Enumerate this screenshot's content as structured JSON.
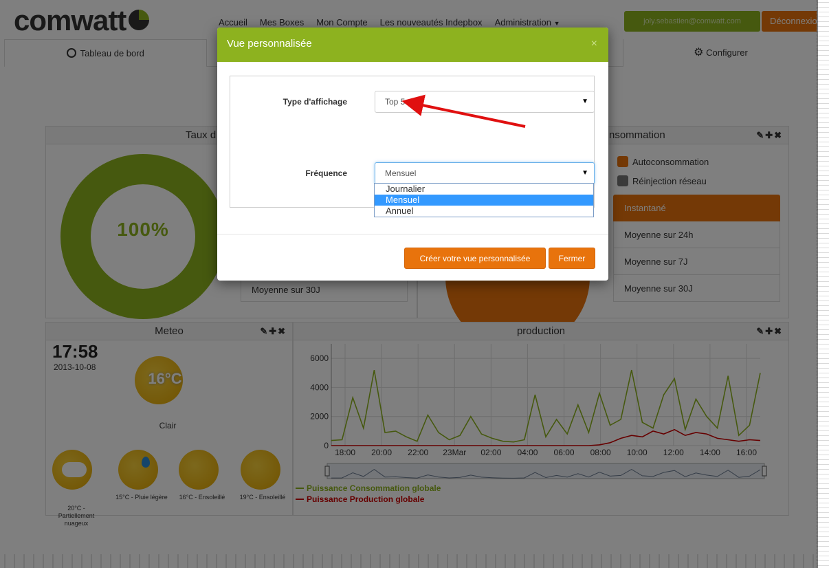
{
  "app": {
    "logo_text": "comwatt",
    "brand_green": "#8db21f",
    "brand_orange": "#e8730c"
  },
  "nav": {
    "items": [
      "Accueil",
      "Mes Boxes",
      "Mon Compte",
      "Les nouveautés Indepbox",
      "Administration"
    ],
    "user_email": "joly.sebastien@comwatt.com",
    "logout_label": "Déconnexion"
  },
  "tabs": {
    "dashboard_label": "Tableau de bord",
    "config_label": "Configurer"
  },
  "panels": {
    "taux_title_partial": "Taux d",
    "conso_title_partial": "nsommation",
    "tools": "✎✚✖",
    "donut_value": "100%",
    "legend": [
      "Autoconsommation",
      "Réinjection réseau"
    ],
    "averages": [
      "Instantané",
      "Moyenne sur 24h",
      "Moyenne sur 7J",
      "Moyenne sur 30J"
    ],
    "left_average": "Moyenne sur 30J",
    "meteo_title": "Meteo",
    "production_title": "production"
  },
  "meteo": {
    "time": "17:58",
    "date": "2013-10-08",
    "temp": "16°C",
    "condition": "Clair",
    "forecast": [
      {
        "label": "20°C - Partiellement nuageux",
        "icon": "sun-cloud-icon"
      },
      {
        "label": "15°C - Pluie légère",
        "icon": "sun-rain-icon"
      },
      {
        "label": "16°C - Ensoleillé",
        "icon": "sun-icon"
      },
      {
        "label": "19°C - Ensoleillé",
        "icon": "sun-icon"
      }
    ]
  },
  "chart_data": {
    "type": "line",
    "title": "production",
    "x_ticks": [
      "18:00",
      "20:00",
      "22:00",
      "23Mar",
      "02:00",
      "04:00",
      "06:00",
      "08:00",
      "10:00",
      "12:00",
      "14:00",
      "16:00"
    ],
    "y_ticks": [
      "0",
      "2000",
      "4000",
      "6000"
    ],
    "ylim": [
      0,
      7000
    ],
    "series": [
      {
        "name": "Puissance Consommation globale",
        "color": "#8db21f",
        "values": [
          350,
          400,
          3300,
          1200,
          5200,
          900,
          1000,
          600,
          300,
          2100,
          900,
          400,
          700,
          2000,
          800,
          500,
          300,
          250,
          400,
          3500,
          600,
          1800,
          800,
          2800,
          900,
          3600,
          1400,
          1800,
          5200,
          1600,
          1200,
          3500,
          4600,
          1100,
          3200,
          2000,
          1200,
          4800,
          700,
          1400,
          5000
        ]
      },
      {
        "name": "Puissance Production globale",
        "color": "#cc0000",
        "values": [
          0,
          0,
          0,
          0,
          0,
          0,
          0,
          0,
          0,
          0,
          0,
          0,
          0,
          0,
          0,
          0,
          0,
          0,
          0,
          0,
          0,
          0,
          0,
          0,
          0,
          50,
          200,
          500,
          700,
          600,
          1000,
          800,
          1100,
          700,
          900,
          800,
          500,
          400,
          300,
          400,
          350
        ]
      }
    ],
    "legend_position": "bottom-left"
  },
  "modal": {
    "title": "Vue personnalisée",
    "close_symbol": "×",
    "type_label": "Type d'affichage",
    "type_value": "Top 5",
    "freq_label": "Fréquence",
    "freq_value": "Mensuel",
    "freq_options": [
      "Journalier",
      "Mensuel",
      "Annuel"
    ],
    "create_button": "Créer votre vue personnalisée",
    "close_button": "Fermer"
  },
  "footer": {
    "flags": [
      "en-flag",
      "fr-flag",
      "de-flag"
    ]
  }
}
